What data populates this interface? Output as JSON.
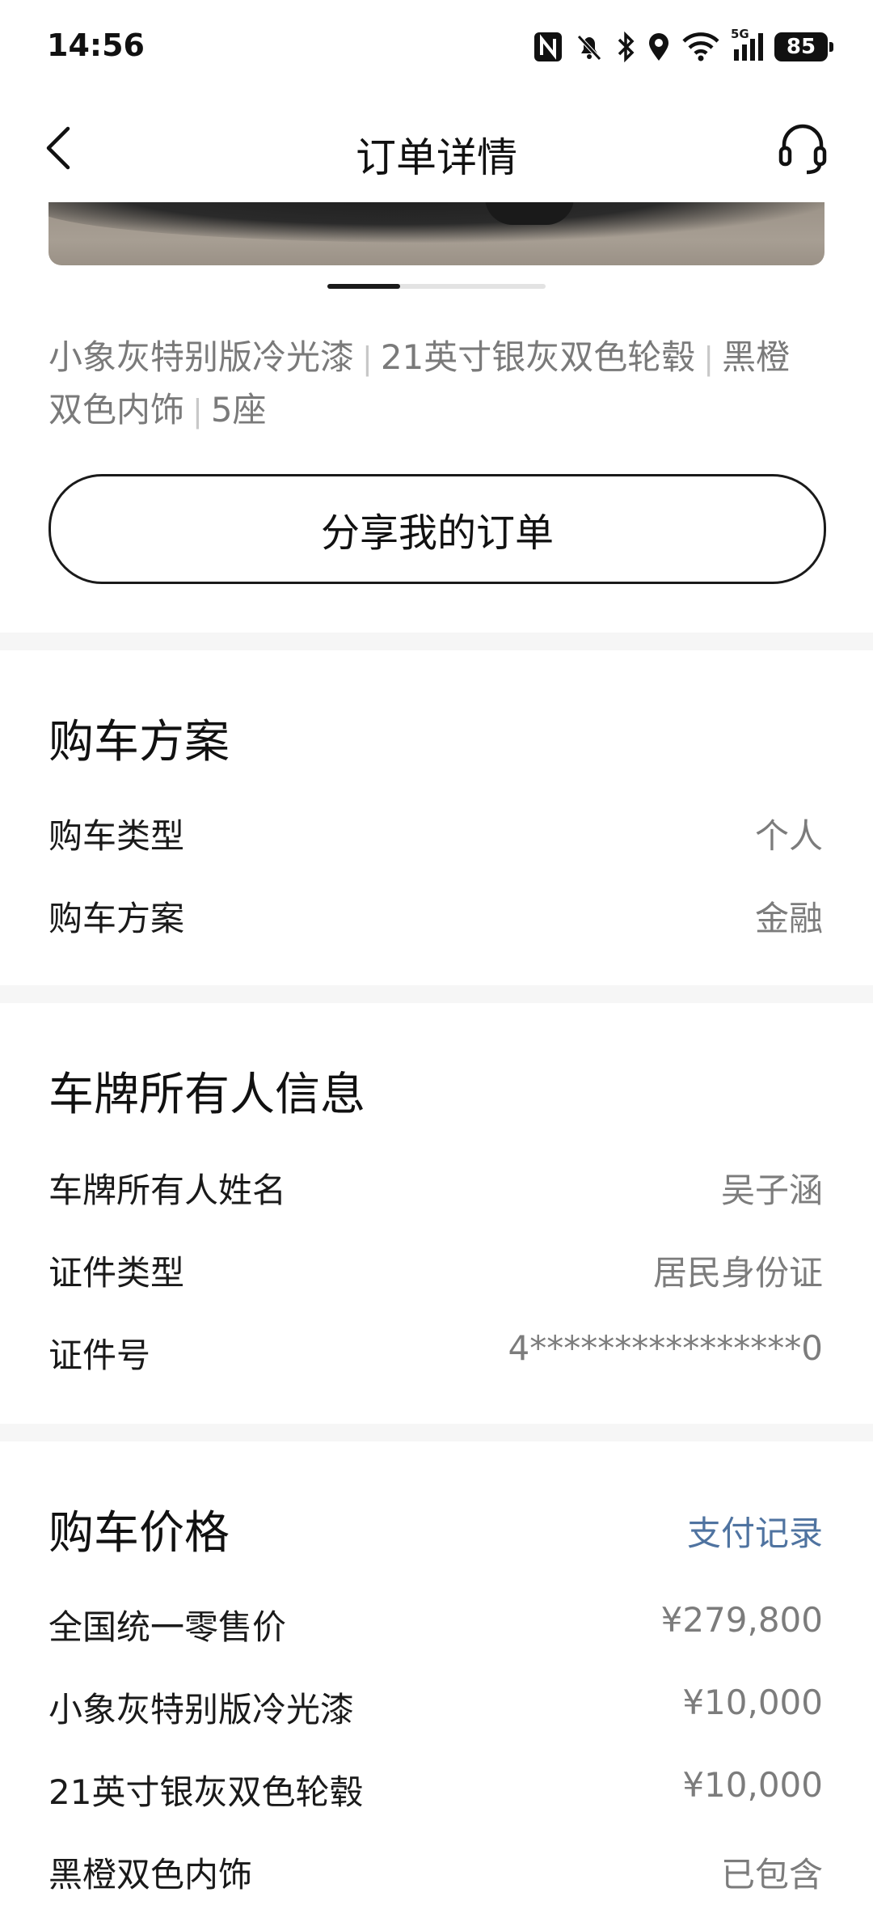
{
  "status_bar": {
    "time": "14:56",
    "network": "5G",
    "battery": "85",
    "icons": [
      "nfc-icon",
      "mute-bell-icon",
      "bluetooth-icon",
      "location-icon",
      "wifi-icon",
      "signal-icon",
      "battery-icon"
    ]
  },
  "nav": {
    "title": "订单详情",
    "back_icon": "chevron-left-icon",
    "support_icon": "headset-icon"
  },
  "carousel": {
    "total": 3,
    "active": 1
  },
  "config": {
    "items": [
      "小象灰特别版冷光漆",
      "21英寸银灰双色轮毂",
      "黑橙",
      "双色内饰",
      "5座"
    ]
  },
  "share_label": "分享我的订单",
  "purchase_plan": {
    "title": "购车方案",
    "rows": [
      {
        "label": "购车类型",
        "value": "个人"
      },
      {
        "label": "购车方案",
        "value": "金融"
      }
    ]
  },
  "owner_info": {
    "title": "车牌所有人信息",
    "rows": [
      {
        "label": "车牌所有人姓名",
        "value": "吴子涵"
      },
      {
        "label": "证件类型",
        "value": "居民身份证"
      },
      {
        "label": "证件号",
        "value": "4****************0"
      }
    ]
  },
  "price": {
    "title": "购车价格",
    "link_label": "支付记录",
    "rows": [
      {
        "label": "全国统一零售价",
        "value": "¥279,800"
      },
      {
        "label": "小象灰特别版冷光漆",
        "value": "¥10,000"
      },
      {
        "label": "21英寸银灰双色轮毂",
        "value": "¥10,000"
      },
      {
        "label": "黑橙双色内饰",
        "value": "已包含"
      }
    ]
  },
  "colors": {
    "accent_link": "#4f73a0",
    "divider": "#f6f6f6"
  }
}
